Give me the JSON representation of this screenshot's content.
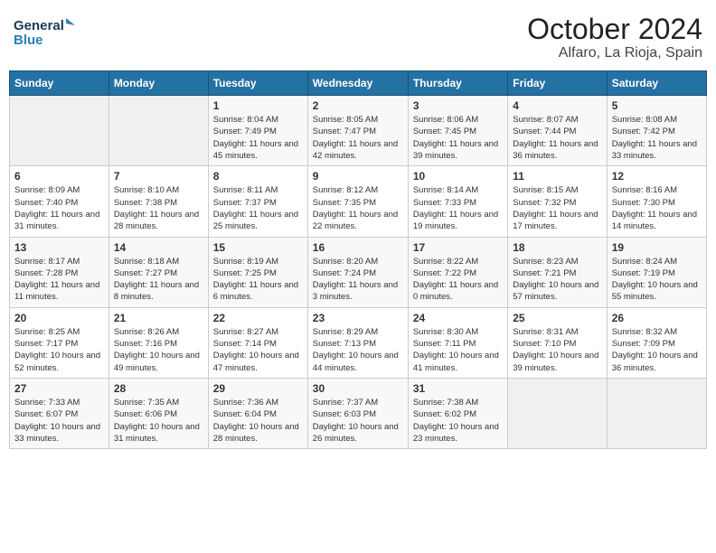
{
  "header": {
    "logo_general": "General",
    "logo_blue": "Blue",
    "month_title": "October 2024",
    "location": "Alfaro, La Rioja, Spain"
  },
  "days_of_week": [
    "Sunday",
    "Monday",
    "Tuesday",
    "Wednesday",
    "Thursday",
    "Friday",
    "Saturday"
  ],
  "weeks": [
    [
      {
        "day": "",
        "info": ""
      },
      {
        "day": "",
        "info": ""
      },
      {
        "day": "1",
        "info": "Sunrise: 8:04 AM\nSunset: 7:49 PM\nDaylight: 11 hours and 45 minutes."
      },
      {
        "day": "2",
        "info": "Sunrise: 8:05 AM\nSunset: 7:47 PM\nDaylight: 11 hours and 42 minutes."
      },
      {
        "day": "3",
        "info": "Sunrise: 8:06 AM\nSunset: 7:45 PM\nDaylight: 11 hours and 39 minutes."
      },
      {
        "day": "4",
        "info": "Sunrise: 8:07 AM\nSunset: 7:44 PM\nDaylight: 11 hours and 36 minutes."
      },
      {
        "day": "5",
        "info": "Sunrise: 8:08 AM\nSunset: 7:42 PM\nDaylight: 11 hours and 33 minutes."
      }
    ],
    [
      {
        "day": "6",
        "info": "Sunrise: 8:09 AM\nSunset: 7:40 PM\nDaylight: 11 hours and 31 minutes."
      },
      {
        "day": "7",
        "info": "Sunrise: 8:10 AM\nSunset: 7:38 PM\nDaylight: 11 hours and 28 minutes."
      },
      {
        "day": "8",
        "info": "Sunrise: 8:11 AM\nSunset: 7:37 PM\nDaylight: 11 hours and 25 minutes."
      },
      {
        "day": "9",
        "info": "Sunrise: 8:12 AM\nSunset: 7:35 PM\nDaylight: 11 hours and 22 minutes."
      },
      {
        "day": "10",
        "info": "Sunrise: 8:14 AM\nSunset: 7:33 PM\nDaylight: 11 hours and 19 minutes."
      },
      {
        "day": "11",
        "info": "Sunrise: 8:15 AM\nSunset: 7:32 PM\nDaylight: 11 hours and 17 minutes."
      },
      {
        "day": "12",
        "info": "Sunrise: 8:16 AM\nSunset: 7:30 PM\nDaylight: 11 hours and 14 minutes."
      }
    ],
    [
      {
        "day": "13",
        "info": "Sunrise: 8:17 AM\nSunset: 7:28 PM\nDaylight: 11 hours and 11 minutes."
      },
      {
        "day": "14",
        "info": "Sunrise: 8:18 AM\nSunset: 7:27 PM\nDaylight: 11 hours and 8 minutes."
      },
      {
        "day": "15",
        "info": "Sunrise: 8:19 AM\nSunset: 7:25 PM\nDaylight: 11 hours and 6 minutes."
      },
      {
        "day": "16",
        "info": "Sunrise: 8:20 AM\nSunset: 7:24 PM\nDaylight: 11 hours and 3 minutes."
      },
      {
        "day": "17",
        "info": "Sunrise: 8:22 AM\nSunset: 7:22 PM\nDaylight: 11 hours and 0 minutes."
      },
      {
        "day": "18",
        "info": "Sunrise: 8:23 AM\nSunset: 7:21 PM\nDaylight: 10 hours and 57 minutes."
      },
      {
        "day": "19",
        "info": "Sunrise: 8:24 AM\nSunset: 7:19 PM\nDaylight: 10 hours and 55 minutes."
      }
    ],
    [
      {
        "day": "20",
        "info": "Sunrise: 8:25 AM\nSunset: 7:17 PM\nDaylight: 10 hours and 52 minutes."
      },
      {
        "day": "21",
        "info": "Sunrise: 8:26 AM\nSunset: 7:16 PM\nDaylight: 10 hours and 49 minutes."
      },
      {
        "day": "22",
        "info": "Sunrise: 8:27 AM\nSunset: 7:14 PM\nDaylight: 10 hours and 47 minutes."
      },
      {
        "day": "23",
        "info": "Sunrise: 8:29 AM\nSunset: 7:13 PM\nDaylight: 10 hours and 44 minutes."
      },
      {
        "day": "24",
        "info": "Sunrise: 8:30 AM\nSunset: 7:11 PM\nDaylight: 10 hours and 41 minutes."
      },
      {
        "day": "25",
        "info": "Sunrise: 8:31 AM\nSunset: 7:10 PM\nDaylight: 10 hours and 39 minutes."
      },
      {
        "day": "26",
        "info": "Sunrise: 8:32 AM\nSunset: 7:09 PM\nDaylight: 10 hours and 36 minutes."
      }
    ],
    [
      {
        "day": "27",
        "info": "Sunrise: 7:33 AM\nSunset: 6:07 PM\nDaylight: 10 hours and 33 minutes."
      },
      {
        "day": "28",
        "info": "Sunrise: 7:35 AM\nSunset: 6:06 PM\nDaylight: 10 hours and 31 minutes."
      },
      {
        "day": "29",
        "info": "Sunrise: 7:36 AM\nSunset: 6:04 PM\nDaylight: 10 hours and 28 minutes."
      },
      {
        "day": "30",
        "info": "Sunrise: 7:37 AM\nSunset: 6:03 PM\nDaylight: 10 hours and 26 minutes."
      },
      {
        "day": "31",
        "info": "Sunrise: 7:38 AM\nSunset: 6:02 PM\nDaylight: 10 hours and 23 minutes."
      },
      {
        "day": "",
        "info": ""
      },
      {
        "day": "",
        "info": ""
      }
    ]
  ]
}
